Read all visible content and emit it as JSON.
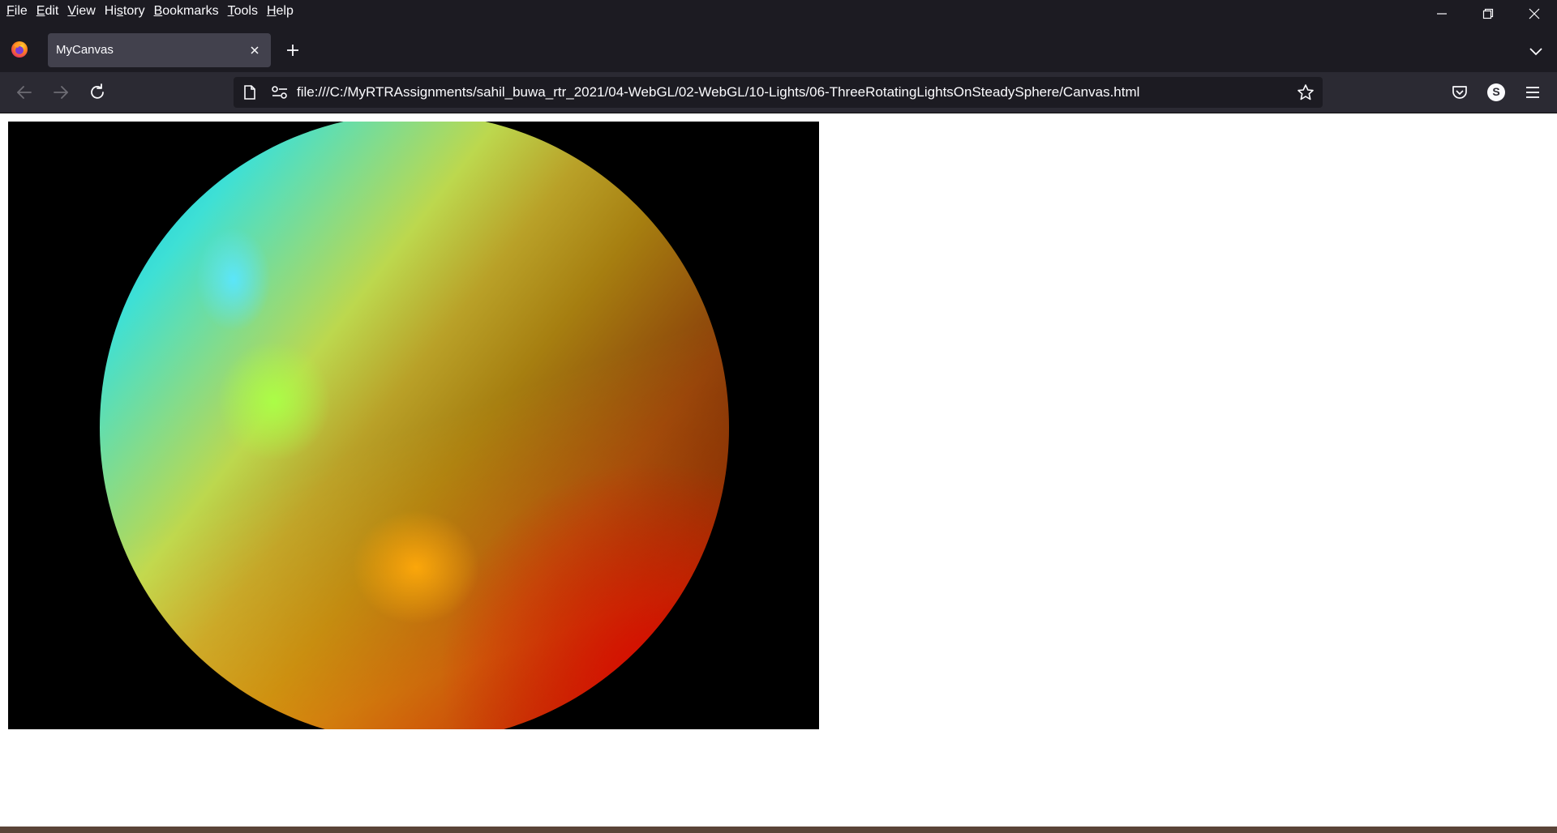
{
  "menubar": {
    "items": [
      {
        "accel": "F",
        "rest": "ile"
      },
      {
        "accel": "E",
        "rest": "dit"
      },
      {
        "accel": "V",
        "rest": "iew"
      },
      {
        "accel": "",
        "pre": "Hi",
        "acc2": "s",
        "rest": "tory"
      },
      {
        "accel": "B",
        "rest": "ookmarks"
      },
      {
        "accel": "T",
        "rest": "ools"
      },
      {
        "accel": "H",
        "rest": "elp"
      }
    ]
  },
  "tabs": [
    {
      "title": "MyCanvas",
      "active": true
    }
  ],
  "navbar": {
    "url": "file:///C:/MyRTRAssignments/sahil_buwa_rtr_2021/04-WebGL/02-WebGL/10-Lights/06-ThreeRotatingLightsOnSteadySphere/Canvas.html",
    "account_initial": "S"
  },
  "colors": {
    "chrome_dark": "#1c1b22",
    "toolbar": "#2b2a33",
    "tab_active": "#42414d",
    "canvas_bg": "#000000",
    "light_cyan": "#5ae6ff",
    "light_green": "#aaff46",
    "light_orange": "#ffa00a"
  },
  "icons": {
    "browser": "firefox-logo-icon",
    "back": "back-arrow-icon",
    "forward": "forward-arrow-icon",
    "reload": "reload-icon",
    "page": "page-icon",
    "permissions": "permissions-icon",
    "bookmark": "star-icon",
    "pocket": "pocket-icon",
    "account": "account-icon",
    "menu": "hamburger-menu-icon"
  }
}
